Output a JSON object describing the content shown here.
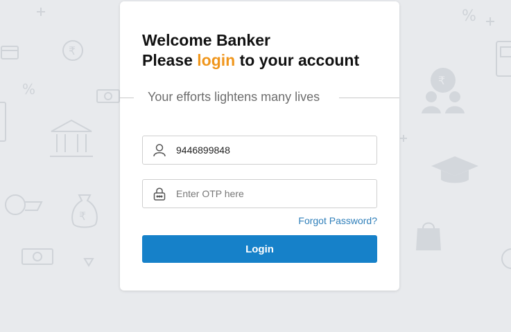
{
  "heading": {
    "line1": "Welcome Banker",
    "line2_before": "Please ",
    "line2_accent": "login",
    "line2_after": " to your account"
  },
  "tagline": "Your efforts lightens many lives",
  "phone_field": {
    "value": "9446899848",
    "icon": "user-icon"
  },
  "otp_field": {
    "placeholder": "Enter OTP here",
    "icon": "lock-icon"
  },
  "forgot_password": "Forgot Password?",
  "login_button": "Login",
  "colors": {
    "accent": "#f0961c",
    "primary": "#1681c9",
    "link": "#2f7fba",
    "background": "#e8eaed"
  }
}
